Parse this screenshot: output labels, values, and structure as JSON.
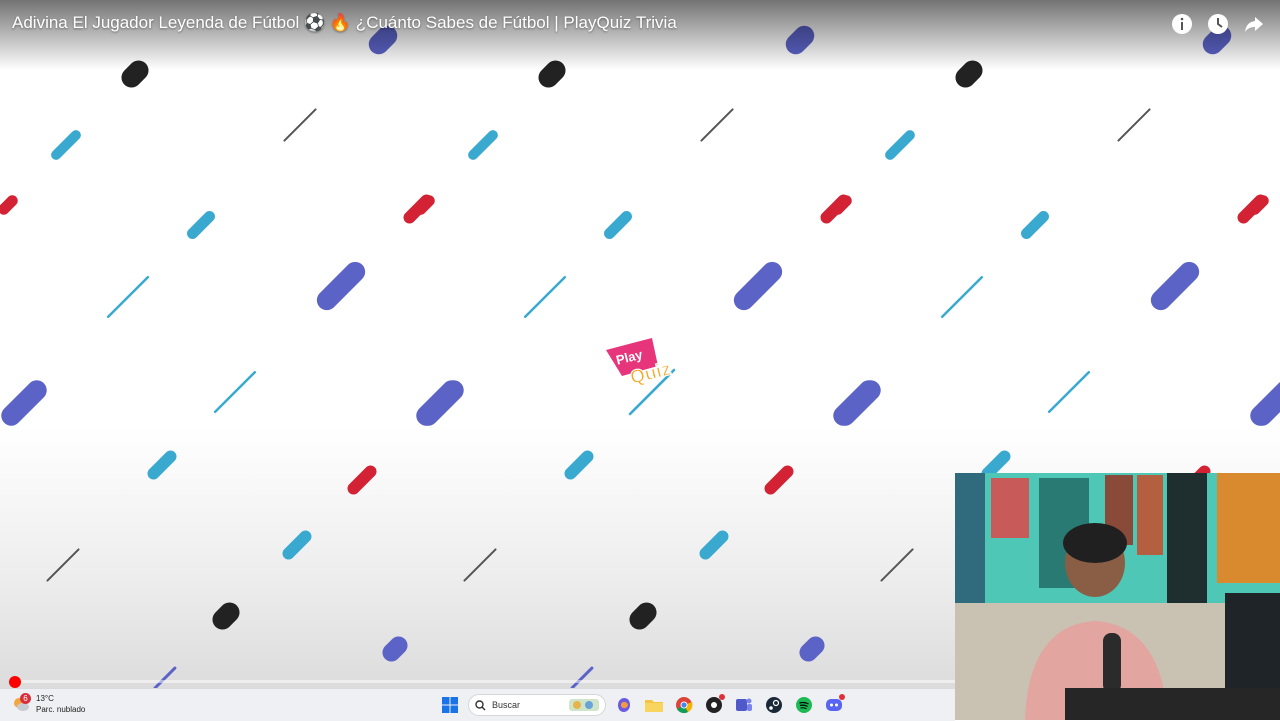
{
  "video": {
    "title": "Adivina El Jugador Leyenda de Fútbol ⚽ 🔥 ¿Cuánto Sabes de Fútbol | PlayQuiz Trivia",
    "progress_fraction": 0.008,
    "top_icons": [
      "info-icon",
      "watch-later-icon",
      "share-icon"
    ]
  },
  "logo": {
    "line1": "Play",
    "line2": "Quiz",
    "pink": "#e6357a",
    "orange": "#f5a623"
  },
  "pattern_colors": {
    "black": "#222222",
    "cyan": "#3aa9cf",
    "red": "#d22234",
    "blue": "#5c63c7",
    "line": "#555555"
  },
  "taskbar": {
    "weather": {
      "badge": "6",
      "temp": "13°C",
      "condition": "Parc. nublado"
    },
    "search_placeholder": "Buscar",
    "apps": [
      "windows-start-icon",
      "search-box",
      "copilot-icon",
      "file-explorer-icon",
      "chrome-icon",
      "app-icon",
      "teams-icon",
      "steam-icon",
      "spotify-icon",
      "discord-icon"
    ]
  }
}
